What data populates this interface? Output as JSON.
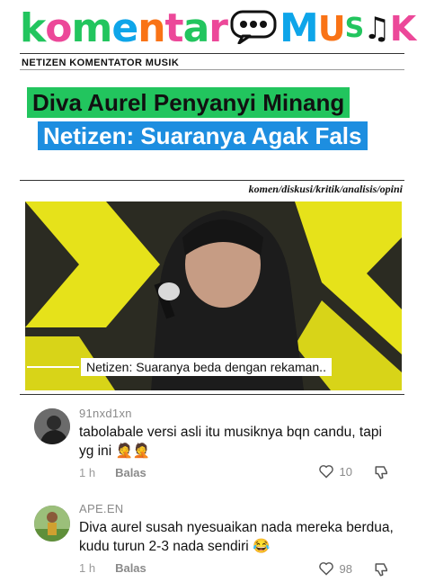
{
  "logo": {
    "part1": "k",
    "part2": "o",
    "part3": "m",
    "part4": "e",
    "part5": "n",
    "part6": "t",
    "part7": "a",
    "part8": "r",
    "part9": "M",
    "part10": "U",
    "part11": "S",
    "part12": "I",
    "part13": "K"
  },
  "tagline": "NETIZEN KOMENTATOR MUSIK",
  "headline": {
    "line1": "Diva Aurel Penyanyi Minang",
    "line2": "Netizen: Suaranya Agak Fals"
  },
  "categories": "komen/diskusi/kritik/analisis/opini",
  "video": {
    "caption": "Netizen: Suaranya beda dengan rekaman.."
  },
  "colors": {
    "green": "#22c55e",
    "blue": "#1d8ee0",
    "pink": "#ec4899",
    "yellow": "#e6e21a"
  },
  "comments": [
    {
      "username": "91nxd1xn",
      "text": "tabolabale versi asli itu musiknya bqn candu, tapi yg ini 🤦🤦",
      "time": "1 h",
      "reply_label": "Balas",
      "likes": "10"
    },
    {
      "username": "APE.EN",
      "text": "Diva aurel susah nyesuaikan nada mereka berdua, kudu turun 2-3 nada sendiri 😂",
      "time": "1 h",
      "reply_label": "Balas",
      "likes": "98"
    }
  ]
}
